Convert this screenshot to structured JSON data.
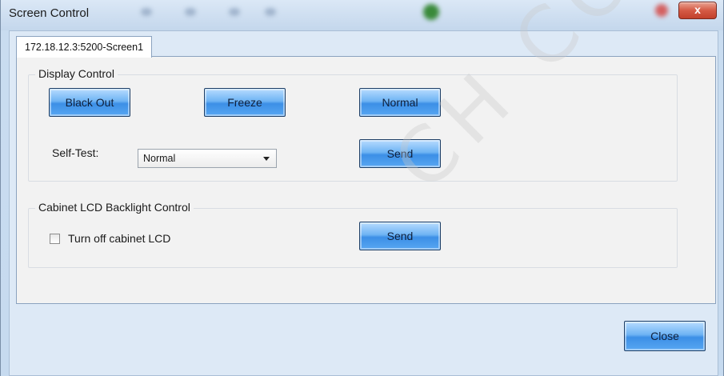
{
  "window": {
    "title": "Screen Control",
    "close_glyph": "x"
  },
  "tabs": [
    {
      "label": "172.18.12.3:5200-Screen1",
      "selected": true
    }
  ],
  "display_control": {
    "title": "Display Control",
    "black_out_label": "Black Out",
    "freeze_label": "Freeze",
    "normal_label": "Normal",
    "self_test_label": "Self-Test:",
    "self_test_value": "Normal",
    "send_label": "Send"
  },
  "cabinet_lcd": {
    "title": "Cabinet LCD Backlight Control",
    "checkbox_label": "Turn off cabinet LCD",
    "checked": false,
    "send_label": "Send"
  },
  "footer": {
    "close_label": "Close"
  },
  "watermark": {
    "text": "CH CO.,LTD"
  },
  "icons": {
    "dropdown": "chevron-down-icon",
    "window_close": "close-icon"
  },
  "colors": {
    "button_blue": "#58a7f2",
    "window_frame": "#c6daef",
    "close_red": "#d55a45"
  }
}
